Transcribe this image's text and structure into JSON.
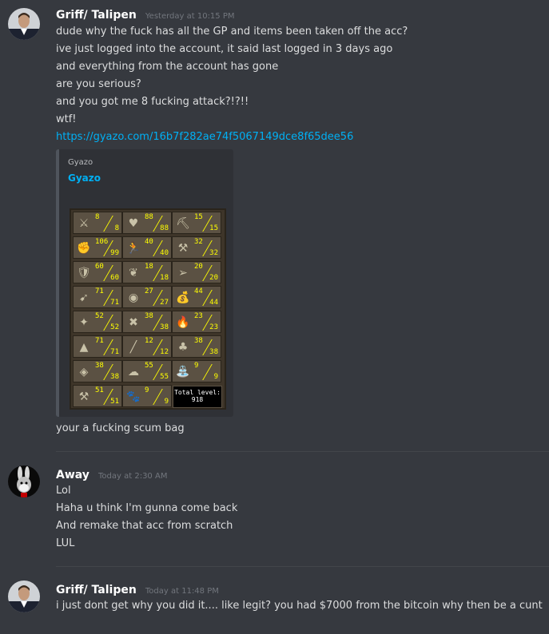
{
  "messages": [
    {
      "author": "Griff/ Talipen",
      "timestamp": "Yesterday at 10:15 PM",
      "lines": [
        "dude why the fuck has all the GP and items been taken off the acc?",
        "ive just logged into the account, it said last logged in 3 days ago",
        "and everything from the account has gone",
        "are you serious?",
        "and you got me 8 fucking attack?!?!!",
        "wtf!"
      ],
      "link": "https://gyazo.com/16b7f282ae74f5067149dce8f65dee56",
      "embed": {
        "provider": "Gyazo",
        "title": "Gyazo",
        "skills": [
          {
            "icon": "sword-icon",
            "glyph": "⚔",
            "current": "8",
            "base": "8"
          },
          {
            "icon": "heart-icon",
            "glyph": "♥",
            "current": "88",
            "base": "88"
          },
          {
            "icon": "pickaxe-icon",
            "glyph": "⛏",
            "current": "15",
            "base": "15"
          },
          {
            "icon": "fist-icon",
            "glyph": "✊",
            "current": "106",
            "base": "99"
          },
          {
            "icon": "running-man-icon",
            "glyph": "🏃",
            "current": "40",
            "base": "40"
          },
          {
            "icon": "anvil-icon",
            "glyph": "⚒",
            "current": "32",
            "base": "32"
          },
          {
            "icon": "shield-icon",
            "glyph": "🛡",
            "current": "60",
            "base": "60"
          },
          {
            "icon": "herb-icon",
            "glyph": "❦",
            "current": "18",
            "base": "18"
          },
          {
            "icon": "fish-icon",
            "glyph": "➢",
            "current": "20",
            "base": "20"
          },
          {
            "icon": "bow-icon",
            "glyph": "➹",
            "current": "71",
            "base": "71"
          },
          {
            "icon": "mask-icon",
            "glyph": "◉",
            "current": "27",
            "base": "27"
          },
          {
            "icon": "sack-icon",
            "glyph": "💰",
            "current": "44",
            "base": "44"
          },
          {
            "icon": "star-icon",
            "glyph": "✦",
            "current": "52",
            "base": "52"
          },
          {
            "icon": "crossed-tools-icon",
            "glyph": "✖",
            "current": "38",
            "base": "38"
          },
          {
            "icon": "fire-icon",
            "glyph": "🔥",
            "current": "23",
            "base": "23"
          },
          {
            "icon": "wizard-hat-icon",
            "glyph": "▲",
            "current": "71",
            "base": "71"
          },
          {
            "icon": "bone-icon",
            "glyph": "╱",
            "current": "12",
            "base": "12"
          },
          {
            "icon": "tree-icon",
            "glyph": "♣",
            "current": "38",
            "base": "38"
          },
          {
            "icon": "rune-icon",
            "glyph": "◈",
            "current": "38",
            "base": "38"
          },
          {
            "icon": "chef-hat-icon",
            "glyph": "☁",
            "current": "55",
            "base": "55"
          },
          {
            "icon": "watering-can-icon",
            "glyph": "⛲",
            "current": "9",
            "base": "9"
          },
          {
            "icon": "hammer-icon",
            "glyph": "⚒",
            "current": "51",
            "base": "51"
          },
          {
            "icon": "paw-icon",
            "glyph": "🐾",
            "current": "9",
            "base": "9"
          }
        ],
        "total_label": "Total level:",
        "total_value": "918"
      },
      "after_embed": "your a fucking scum bag"
    },
    {
      "author": "Away",
      "timestamp": "Today at 2:30 AM",
      "lines": [
        "Lol",
        "Haha u think I'm gunna come back",
        "And remake that acc from scratch",
        "LUL"
      ]
    },
    {
      "author": "Griff/ Talipen",
      "timestamp": "Today at 11:48 PM",
      "lines": [
        "i just dont get why you did it.... like legit? you had $7000 from the bitcoin why then be a cunt"
      ]
    }
  ],
  "colors": {
    "background": "#36393f",
    "link": "#00b0f4",
    "author": "#ffffff",
    "timestamp": "#72767d"
  }
}
